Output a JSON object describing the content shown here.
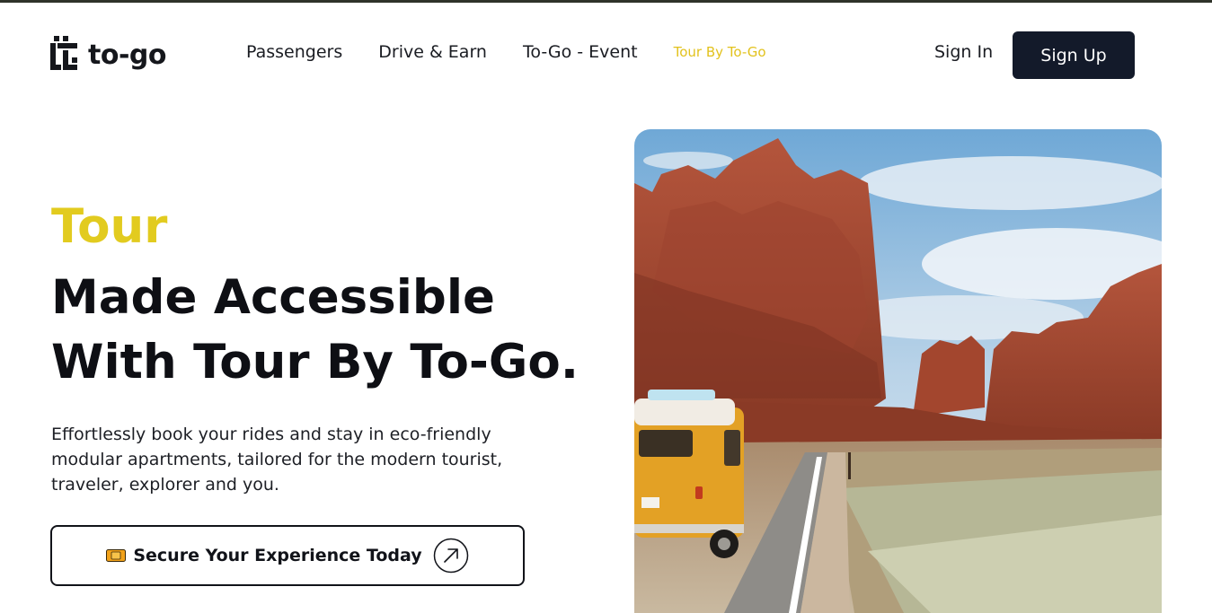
{
  "brand": {
    "name": "to-go"
  },
  "nav": {
    "items": [
      {
        "label": "Passengers"
      },
      {
        "label": "Drive & Earn"
      },
      {
        "label": "To-Go - Event"
      },
      {
        "label": "Tour By To-Go",
        "active": true
      }
    ]
  },
  "auth": {
    "sign_in": "Sign In",
    "sign_up": "Sign Up"
  },
  "hero": {
    "kicker": "Tour",
    "title_line1": "Made Accessible",
    "title_line2": "With Tour By To-Go.",
    "description": "Effortlessly book your rides and stay in eco-friendly modular apartments, tailored for the modern tourist, traveler, explorer and you.",
    "cta_label": "Secure Your Experience Today",
    "cta_icon": "ticket-icon",
    "cta_arrow_icon": "arrow-up-right-icon"
  },
  "image": {
    "subject": "desert-road-van-photo"
  },
  "colors": {
    "accent": "#e2cb1f",
    "active_nav": "#e2c21d",
    "dark": "#131a2a",
    "text": "#0e0f14"
  }
}
